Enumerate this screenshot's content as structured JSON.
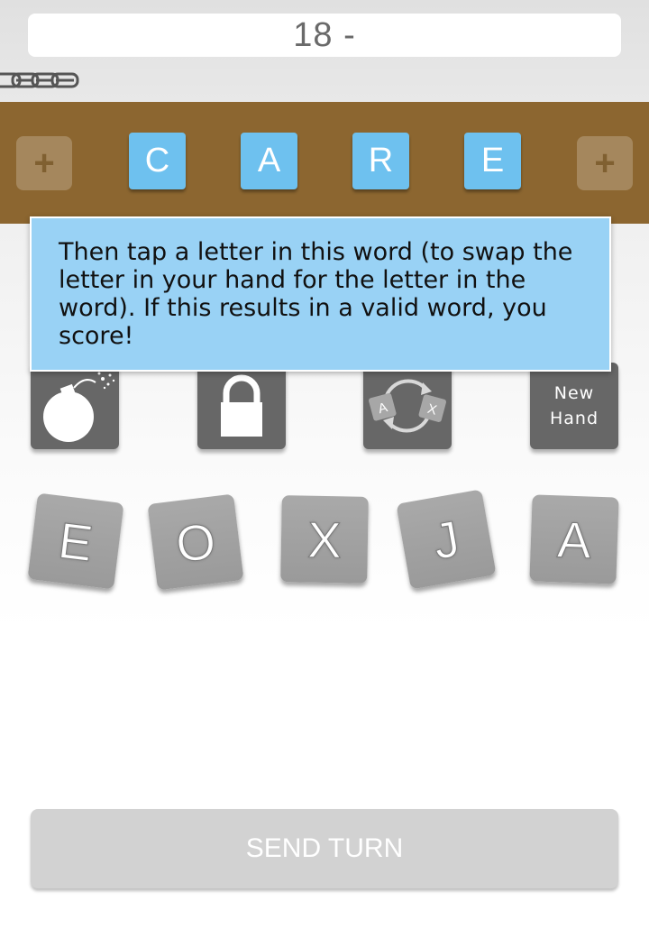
{
  "header": {
    "score": "18 -"
  },
  "chain_icon": "chain-icon",
  "word": {
    "add_left_label": "+",
    "add_right_label": "+",
    "letters": [
      "C",
      "A",
      "R",
      "E"
    ]
  },
  "tooltip": {
    "text": "Then tap a letter in this word (to swap the letter in your hand for the letter in the word). If this results in a valid word, you score!"
  },
  "powerups": {
    "bomb_icon": "bomb-icon",
    "lock_icon": "lock-icon",
    "swap_icon": "swap-icon",
    "swap_letters": [
      "A",
      "X"
    ],
    "new_hand_line1": "New",
    "new_hand_line2": "Hand"
  },
  "hand": {
    "letters": [
      "E",
      "O",
      "X",
      "J",
      "A"
    ]
  },
  "send_turn": {
    "label": "SEND TURN"
  },
  "colors": {
    "word_strip": "#8c6630",
    "word_tile": "#6ec1ef",
    "tooltip": "#99d2f5",
    "powerup": "#676767",
    "hand_tile": "#a3a3a3",
    "send_button": "#d2d2d2"
  }
}
